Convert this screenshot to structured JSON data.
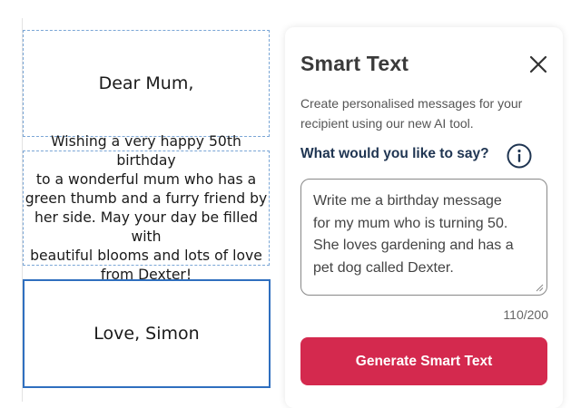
{
  "card": {
    "greeting": "Dear Mum,",
    "message_lines": [
      "Wishing a very happy 50th birthday",
      "to a wonderful mum who has a",
      "green thumb and a furry friend by",
      "her side. May your day be filled with",
      "beautiful blooms and lots of love",
      "from Dexter!"
    ],
    "signoff": "Love, Simon"
  },
  "panel": {
    "title": "Smart Text",
    "close_icon": "close-icon",
    "description_lines": [
      "Create personalised messages for your",
      "recipient using our new AI tool."
    ],
    "question": "What would you like to say?",
    "info_icon": "info-icon",
    "prompt_lines": [
      "Write me a birthday message",
      "for my mum who is turning 50.",
      "She loves gardening and has a",
      "pet dog called Dexter."
    ],
    "char_count": "110/200",
    "generate_label": "Generate Smart Text"
  },
  "colors": {
    "accent": "#d4294e",
    "selected_border": "#2f6fbf",
    "dashed_border": "#7aa6d6",
    "question_text": "#1f3552"
  }
}
